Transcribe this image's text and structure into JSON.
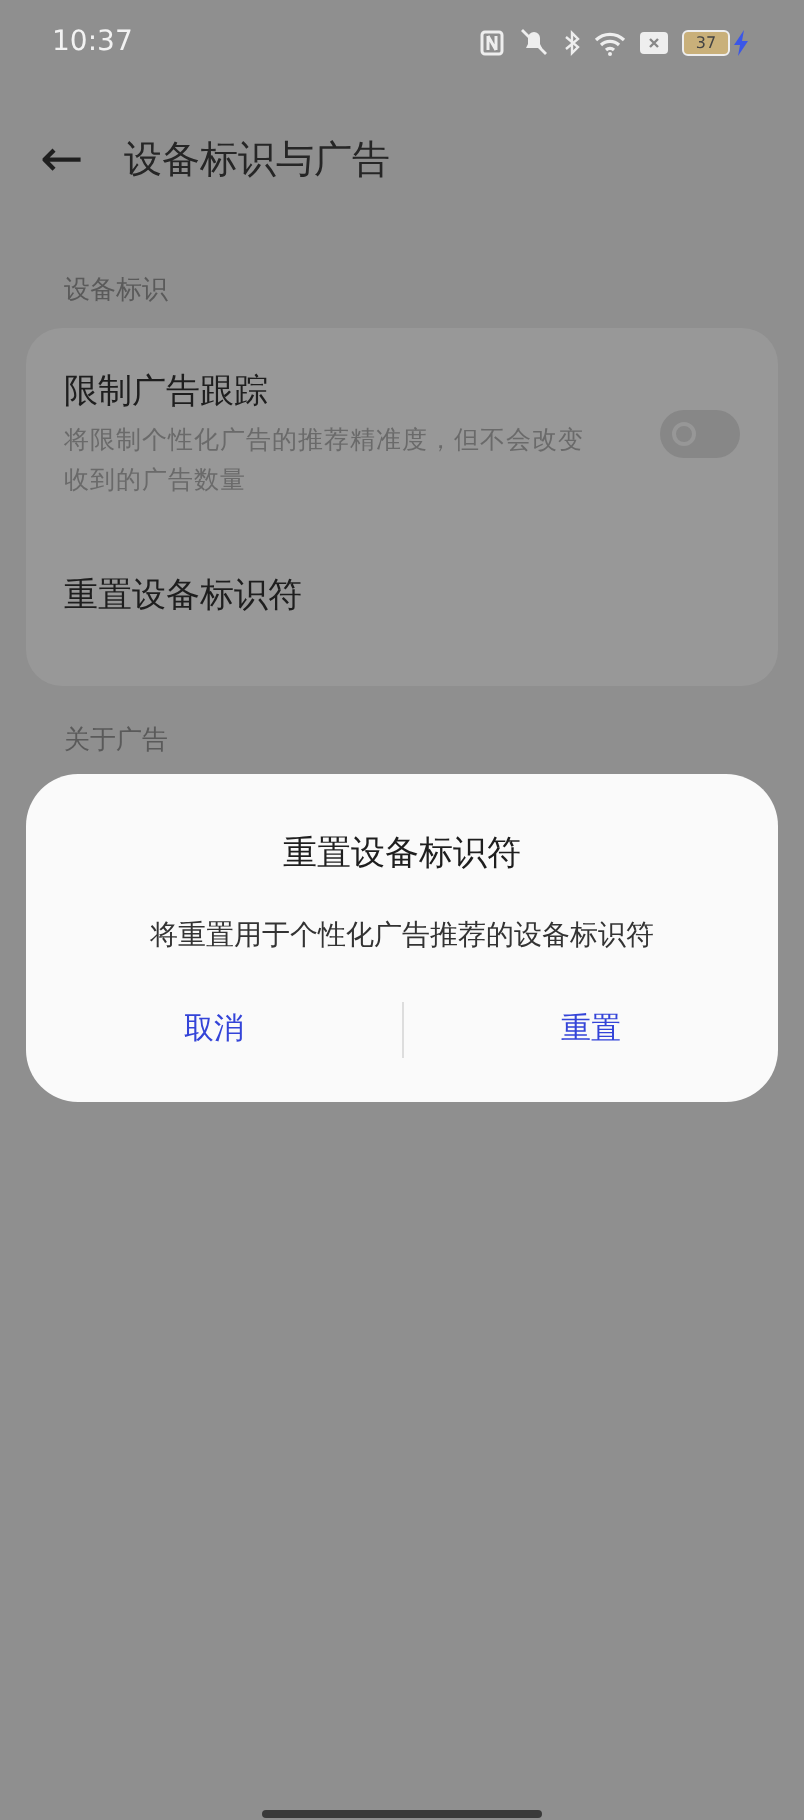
{
  "status_bar": {
    "time": "10:37",
    "battery": "37",
    "charging": true
  },
  "header": {
    "back_icon": "←",
    "title": "设备标识与广告"
  },
  "sections": [
    {
      "label": "设备标识",
      "items": [
        {
          "kind": "toggle",
          "title": "限制广告跟踪",
          "subtitle": "将限制个性化广告的推荐精准度，但不会改变收到的广告数量",
          "on": false
        },
        {
          "kind": "link",
          "title": "重置设备标识符"
        }
      ]
    },
    {
      "label": "关于广告"
    }
  ],
  "dialog": {
    "title": "重置设备标识符",
    "message": "将重置用于个性化广告推荐的设备标识符",
    "buttons": [
      "取消",
      "重置"
    ]
  }
}
